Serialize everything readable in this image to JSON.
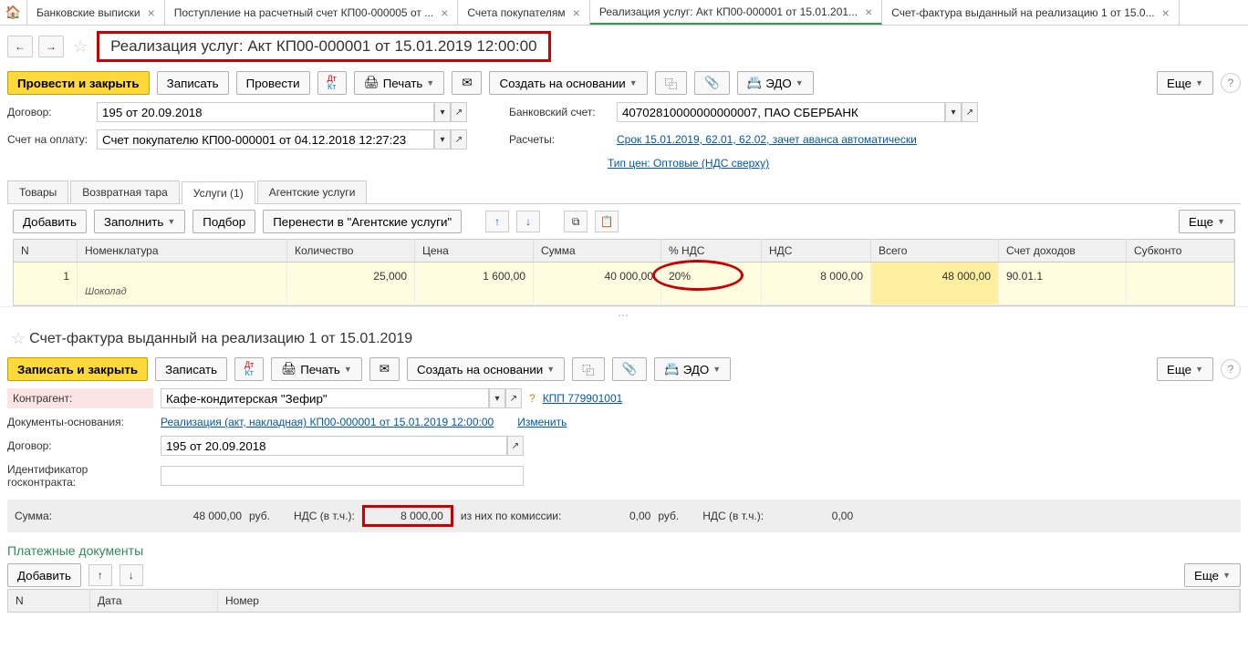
{
  "tabs": {
    "t0": "Банковские выписки",
    "t1": "Поступление на расчетный счет КП00-000005 от ...",
    "t2": "Счета покупателям",
    "t3": "Реализация услуг: Акт КП00-000001 от 15.01.201...",
    "t4": "Счет-фактура выданный на реализацию 1 от 15.0..."
  },
  "doc1": {
    "title": "Реализация услуг: Акт КП00-000001 от 15.01.2019 12:00:00",
    "btn_post_close": "Провести и закрыть",
    "btn_write": "Записать",
    "btn_post": "Провести",
    "btn_print": "Печать",
    "btn_create": "Создать на основании",
    "btn_edo": "ЭДО",
    "btn_more": "Еще",
    "lbl_contract": "Договор:",
    "val_contract": "195 от 20.09.2018",
    "lbl_bank": "Банковский счет:",
    "val_bank": "40702810000000000007, ПАО СБЕРБАНК",
    "lbl_invoice": "Счет на оплату:",
    "val_invoice": "Счет покупателю КП00-000001 от 04.12.2018 12:27:23",
    "lbl_calc": "Расчеты:",
    "link_calc": "Срок 15.01.2019, 62.01, 62.02, зачет аванса автоматически",
    "link_price": "Тип цен: Оптовые (НДС сверху)",
    "tab_goods": "Товары",
    "tab_ret": "Возвратная тара",
    "tab_serv": "Услуги (1)",
    "tab_agent": "Агентские услуги",
    "btn_add": "Добавить",
    "btn_fill": "Заполнить",
    "btn_pick": "Подбор",
    "btn_move": "Перенести в \"Агентские услуги\""
  },
  "grid": {
    "h_n": "N",
    "h_nom": "Номенклатура",
    "h_qty": "Количество",
    "h_price": "Цена",
    "h_sum": "Сумма",
    "h_vat": "% НДС",
    "h_vats": "НДС",
    "h_tot": "Всего",
    "h_acc": "Счет доходов",
    "h_sub": "Субконто",
    "r_n": "1",
    "r_nom": "Шоколад",
    "r_qty": "25,000",
    "r_price": "1 600,00",
    "r_sum": "40 000,00",
    "r_vat": "20%",
    "r_vats": "8 000,00",
    "r_tot": "48 000,00",
    "r_acc": "90.01.1"
  },
  "doc2": {
    "title": "Счет-фактура выданный на реализацию 1 от 15.01.2019",
    "btn_write_close": "Записать и закрыть",
    "btn_write": "Записать",
    "btn_print": "Печать",
    "btn_create": "Создать на основании",
    "btn_edo": "ЭДО",
    "btn_more": "Еще",
    "lbl_kontr": "Контрагент:",
    "val_kontr": "Кафе-кондитерская \"Зефир\"",
    "link_kpp": "КПП 779901001",
    "lbl_basis": "Документы-основания:",
    "link_basis": "Реализация (акт, накладная) КП00-000001 от 15.01.2019 12:00:00",
    "link_change": "Изменить",
    "lbl_contract": "Договор:",
    "val_contract": "195 от 20.09.2018",
    "lbl_gos": "Идентификатор госконтракта:",
    "lbl_sum": "Сумма:",
    "val_sum": "48 000,00",
    "rub": "руб.",
    "lbl_nds": "НДС (в т.ч.):",
    "val_nds": "8 000,00",
    "lbl_komm": "из них по комиссии:",
    "val_komm": "0,00",
    "val_nds2": "0,00",
    "h_pay": "Платежные документы",
    "btn_add": "Добавить",
    "g_n": "N",
    "g_date": "Дата",
    "g_num": "Номер"
  }
}
